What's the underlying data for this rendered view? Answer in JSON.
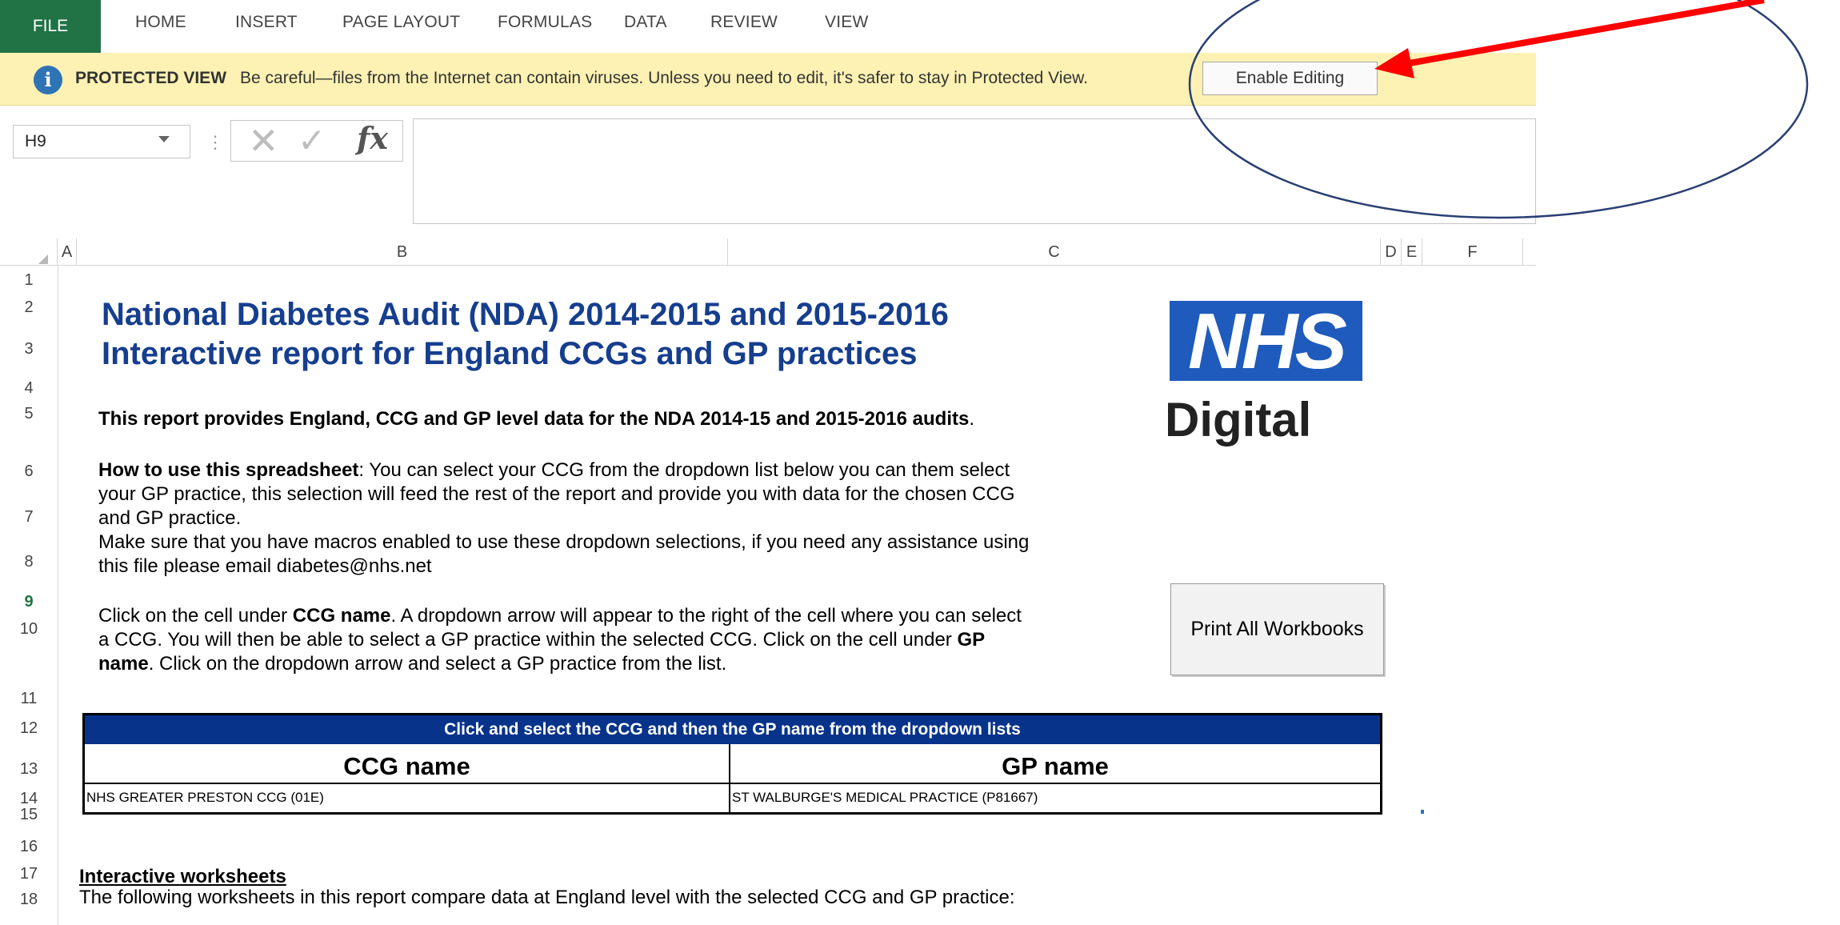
{
  "ribbon": {
    "tabs": [
      "FILE",
      "HOME",
      "INSERT",
      "PAGE LAYOUT",
      "FORMULAS",
      "DATA",
      "REVIEW",
      "VIEW"
    ]
  },
  "protected_view": {
    "icon": "info-icon",
    "title": "PROTECTED VIEW",
    "message": "Be careful—files from the Internet can contain viruses. Unless you need to edit, it's safer to stay in Protected View.",
    "button_label": "Enable Editing"
  },
  "formula_bar": {
    "name_box": "H9",
    "separator": "⋮",
    "cancel_glyph": "✕",
    "enter_glyph": "✓",
    "fx_label": "fx",
    "formula_value": ""
  },
  "columns": [
    "A",
    "B",
    "C",
    "D",
    "E",
    "F"
  ],
  "rows": [
    "1",
    "2",
    "3",
    "4",
    "5",
    "6",
    "7",
    "8",
    "9",
    "10",
    "11",
    "12",
    "13",
    "14",
    "15",
    "16",
    "17",
    "18"
  ],
  "active_row": "9",
  "sheet": {
    "title_line1": "National Diabetes Audit (NDA) 2014-2015 and 2015-2016",
    "title_line2": "Interactive report for England CCGs and GP practices",
    "intro_bold": "This report provides England, CCG and GP level data for the NDA 2014-15 and 2015-2016 audits",
    "intro_end": ".",
    "howto_bold": "How to use this spreadsheet",
    "howto_line1": ": You can select your CCG from the dropdown list below you can them select",
    "howto_line2": "your GP practice, this selection will feed the rest of the report and provide you with data for the chosen CCG",
    "howto_line3": "and GP practice.",
    "macros_line1": "Make sure that you have macros enabled to use these dropdown selections, if you need any assistance  using",
    "macros_line2": "this file please email diabetes@nhs.net",
    "click_a": "Click on the cell under ",
    "click_ccg": "CCG name",
    "click_b": ". A dropdown arrow will appear to the right of the cell where you can select",
    "click_line2a": "a CCG. You will then be able to select a GP practice within the selected CCG. Click on the cell under ",
    "click_gp": "GP",
    "click_line3a": "name",
    "click_line3b": ". Click on the dropdown arrow and select a GP practice from the list.",
    "logo_nhs": "NHS",
    "logo_digital": "Digital",
    "print_button": "Print All Workbooks",
    "selection": {
      "header": "Click and select the CCG and then the GP name from the dropdown lists",
      "ccg_label": "CCG name",
      "gp_label": "GP name",
      "ccg_value": "NHS GREATER PRESTON CCG (01E)",
      "gp_value": "ST WALBURGE'S MEDICAL PRACTICE (P81667)"
    },
    "interactive_heading": "Interactive worksheets",
    "interactive_text": "The following worksheets in this report compare data at England level with the selected CCG and GP practice:"
  },
  "annotation": {
    "arrow_color": "#ff0000",
    "ellipse_color": "#2a3f73"
  }
}
